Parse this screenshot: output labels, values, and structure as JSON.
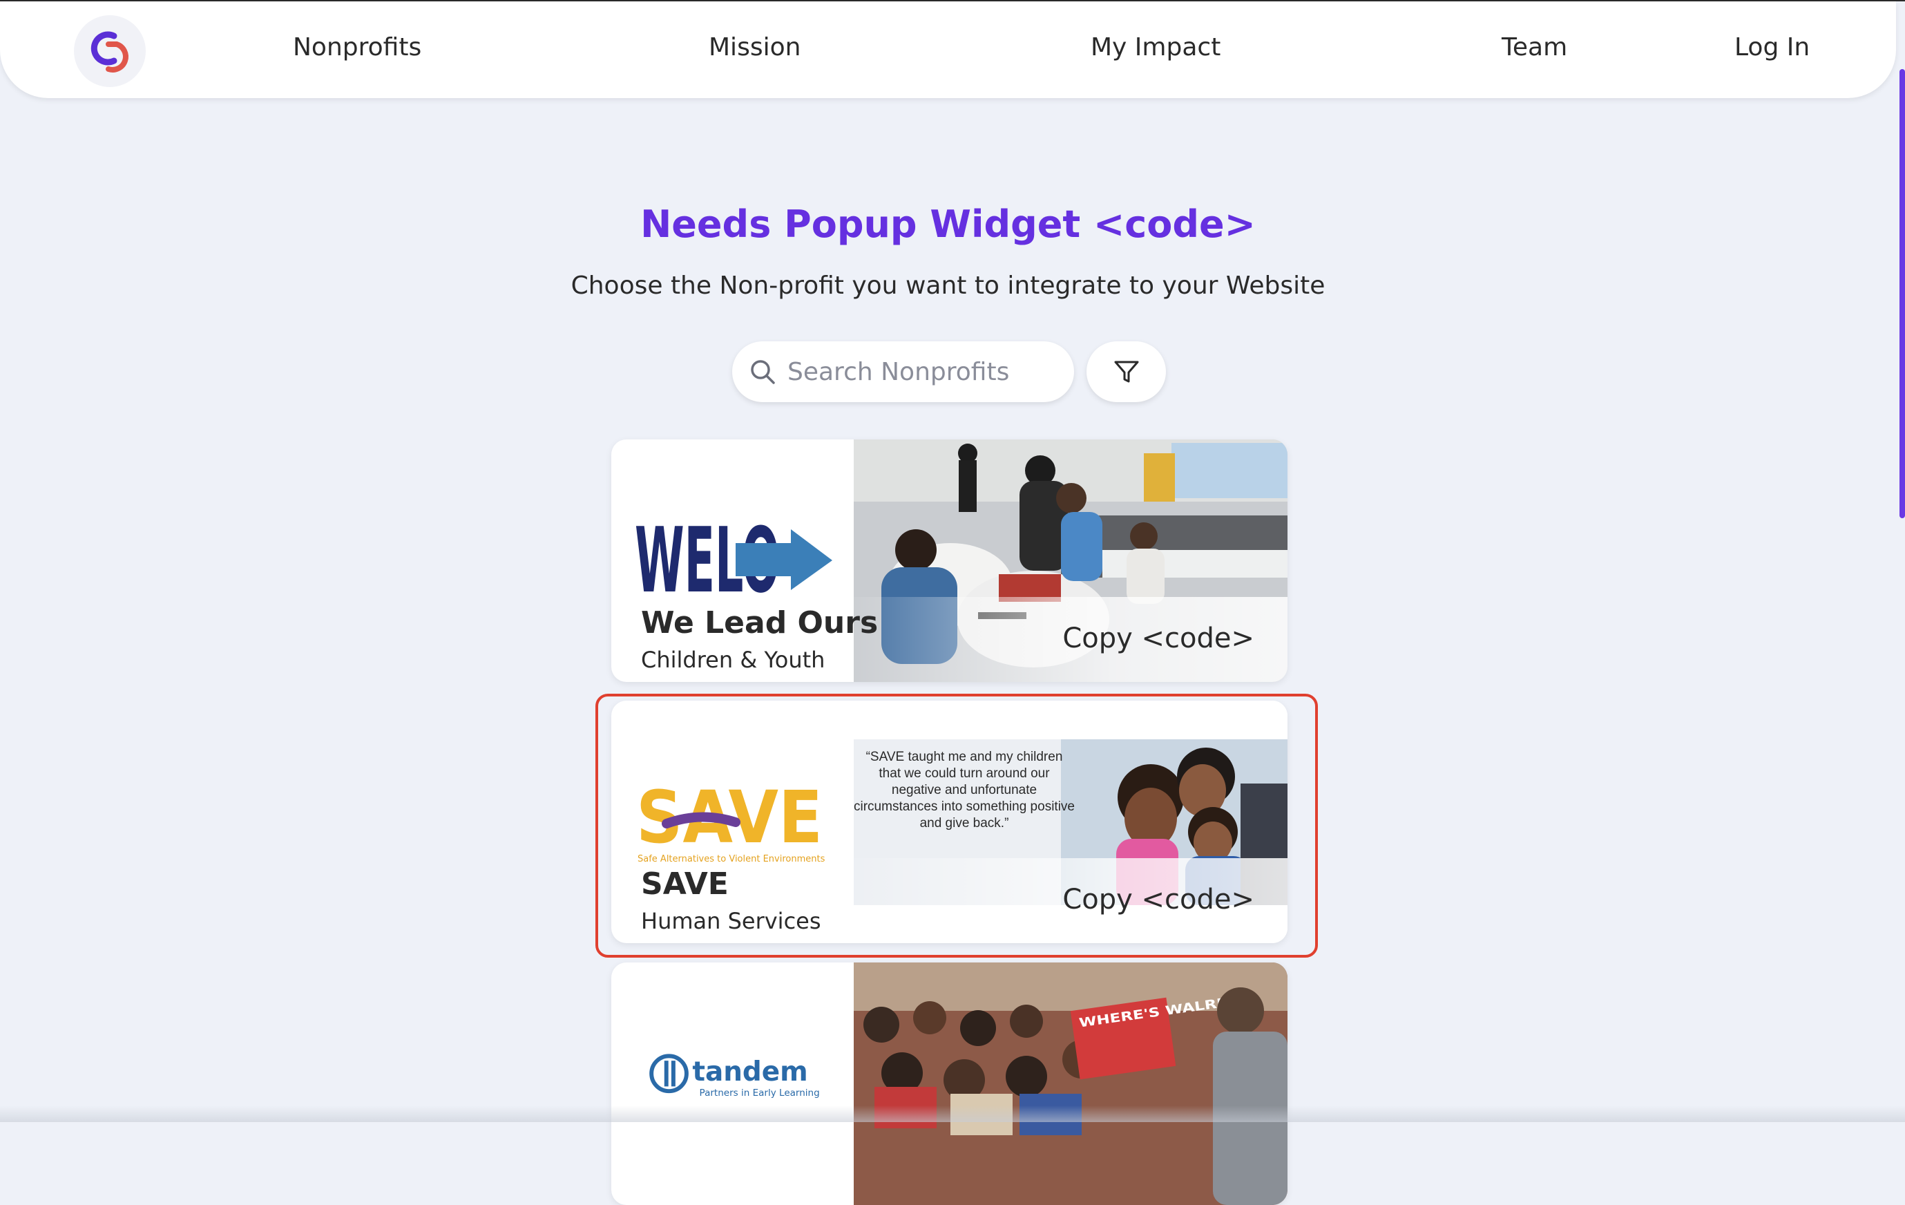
{
  "nav": {
    "logo_alt": "GD",
    "items": [
      "Nonprofits",
      "Mission",
      "My Impact",
      "Team",
      "Log In"
    ]
  },
  "header": {
    "title": "Needs Popup Widget <code>",
    "subtitle": "Choose the Non-profit you want to integrate to your Website"
  },
  "search": {
    "placeholder": "Search Nonprofits",
    "value": ""
  },
  "cards": [
    {
      "logo_text": "WELO",
      "name": "We Lead Ours",
      "category": "Children & Youth",
      "copy_label": "Copy <code>"
    },
    {
      "logo_text": "SAVE",
      "logo_tagline": "Safe Alternatives to Violent Environments",
      "quote": "“SAVE taught me and my children that we could turn around our negative and unfortunate circumstances into something positive and give back.”",
      "name": "SAVE",
      "category": "Human Services",
      "copy_label": "Copy <code>"
    },
    {
      "logo_text": "tandem",
      "logo_tagline": "Partners in Early Learning",
      "photo_sign": "WHERE'S WALRUS?",
      "name": "",
      "category": "",
      "copy_label": ""
    }
  ],
  "colors": {
    "accent": "#6530e0",
    "highlight": "#e0402f",
    "background": "#eef1f8"
  }
}
